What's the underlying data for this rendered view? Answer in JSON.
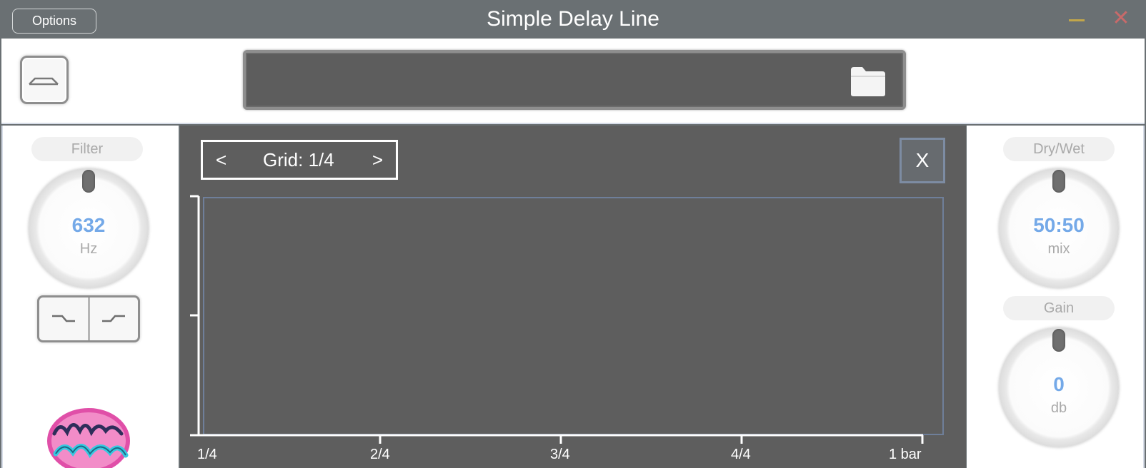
{
  "window": {
    "title": "Simple Delay Line",
    "options_label": "Options",
    "minimize_color": "#c2a64a",
    "close_color": "#c86a6a"
  },
  "file": {
    "value": ""
  },
  "left_panel": {
    "filter": {
      "label": "Filter",
      "value": "632",
      "unit": "Hz"
    }
  },
  "right_panel": {
    "drywet": {
      "label": "Dry/Wet",
      "value": "50:50",
      "unit": "mix"
    },
    "gain": {
      "label": "Gain",
      "value": "0",
      "unit": "db"
    }
  },
  "editor": {
    "grid_prev": "<",
    "grid_label": "Grid: 1/4",
    "grid_next": ">",
    "close_label": "X",
    "x_ticks": [
      "1/4",
      "2/4",
      "3/4",
      "4/4",
      "1 bar"
    ]
  },
  "colors": {
    "accent_value": "#74a9e8",
    "editor_bg": "#5e5e5e",
    "titlebar_bg": "#6a7073"
  }
}
